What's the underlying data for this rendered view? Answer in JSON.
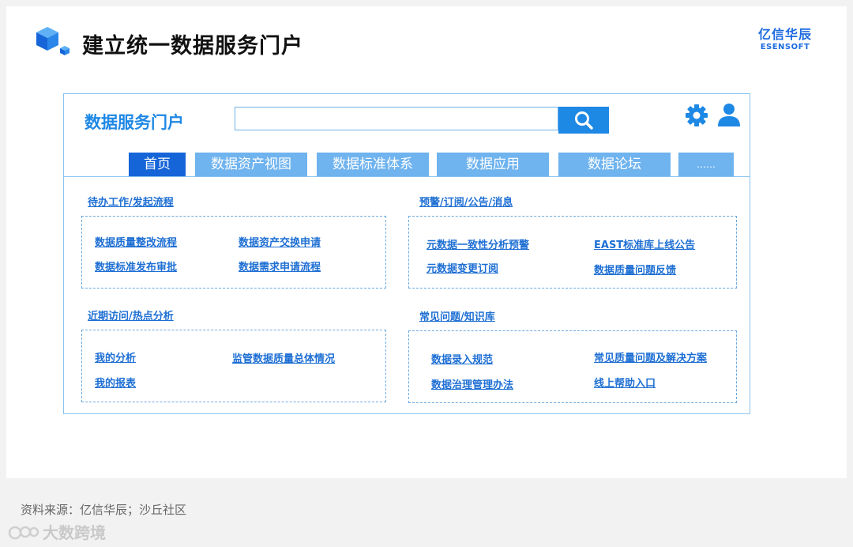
{
  "slide": {
    "title": "建立统一数据服务门户",
    "brand_cn": "亿信华辰",
    "brand_en": "ESENSOFT"
  },
  "portal": {
    "title": "数据服务门户",
    "search": {
      "value": "",
      "placeholder": ""
    },
    "tabs": [
      {
        "label": "首页",
        "active": true
      },
      {
        "label": "数据资产视图",
        "active": false
      },
      {
        "label": "数据标准体系",
        "active": false
      },
      {
        "label": "数据应用",
        "active": false
      },
      {
        "label": "数据论坛",
        "active": false
      },
      {
        "label": "……",
        "active": false
      }
    ],
    "sections": {
      "todo": {
        "label": "待办工作/发起流程",
        "links": [
          "数据质量整改流程",
          "数据资产交换申请",
          "数据标准发布审批",
          "数据需求申请流程"
        ]
      },
      "alerts": {
        "label": "预警/订阅/公告/消息",
        "links": [
          "元数据一致性分析预警",
          "EAST标准库上线公告",
          "元数据变更订阅",
          "数据质量问题反馈"
        ]
      },
      "recent": {
        "label": "近期访问/热点分析",
        "links": [
          "我的分析",
          "监管数据质量总体情况",
          "我的报表"
        ]
      },
      "faq": {
        "label": "常见问题/知识库",
        "links": [
          "数据录入规范",
          "常见质量问题及解决方案",
          "数据治理管理办法",
          "线上帮助入口"
        ]
      }
    }
  },
  "source": "资料来源：亿信华辰；沙丘社区",
  "watermark": "大数跨境",
  "icons": [
    "cube-logo-icon",
    "search-icon",
    "gear-icon",
    "user-icon",
    "watermark-logo-icon"
  ],
  "colors": {
    "accent": "#1e88e5",
    "tab_inactive": "#6fb3ef",
    "tab_active": "#1565d8",
    "link": "#1e6fd4"
  }
}
